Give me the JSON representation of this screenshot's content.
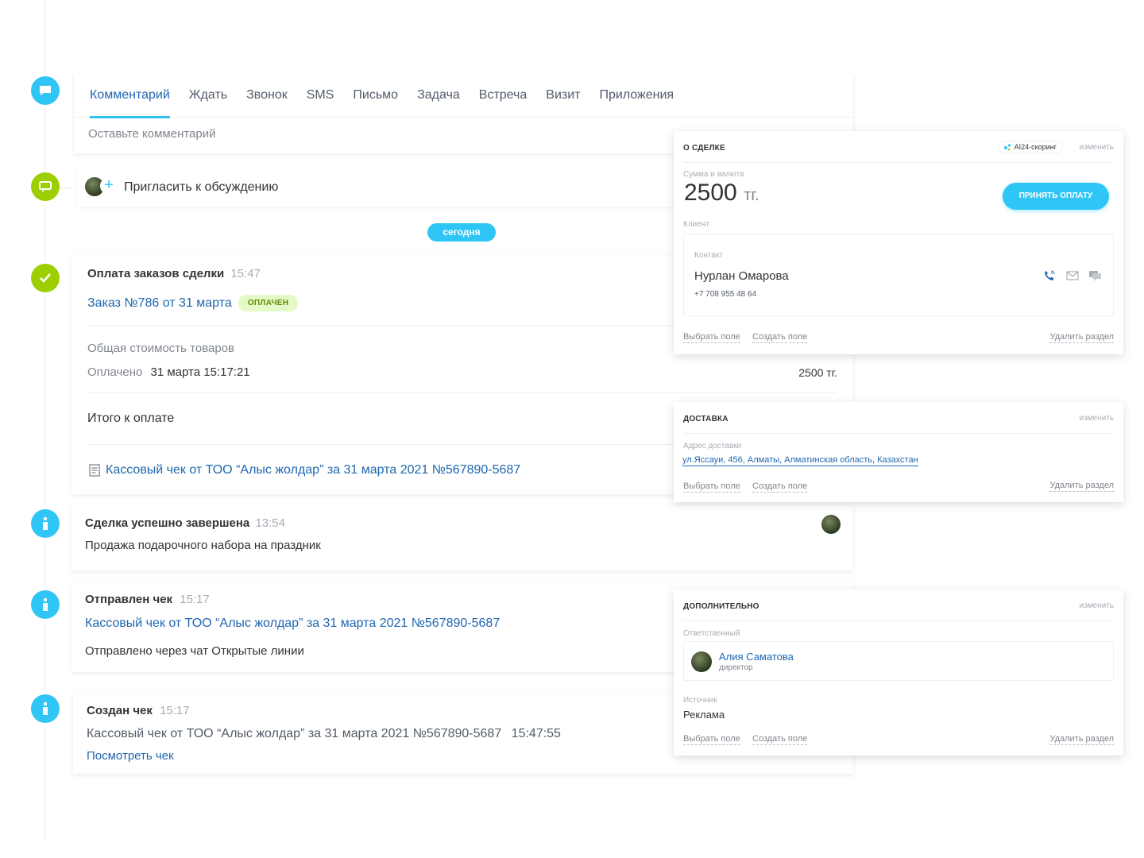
{
  "tabs": [
    "Комментарий",
    "Ждать",
    "Звонок",
    "SMS",
    "Письмо",
    "Задача",
    "Встреча",
    "Визит",
    "Приложения"
  ],
  "comment_placeholder": "Оставьте комментарий",
  "invite": {
    "label": "Пригласить к обсуждению"
  },
  "today_label": "сегодня",
  "payment": {
    "title": "Оплата заказов сделки",
    "time": "15:47",
    "order_link": "Заказ №786 от 31 марта",
    "status_badge": "ОПЛАЧЕН",
    "total_label": "Общая стоимость товаров",
    "paid_label": "Оплачено",
    "paid_datetime": "31 марта 15:17:21",
    "paid_amount": "2500 тг.",
    "due_label": "Итого к оплате",
    "receipt_link": "Кассовый чек от ТОО “Алыс жолдар” за 31 марта 2021 №567890-5687"
  },
  "deal_done": {
    "title": "Сделка успешно завершена",
    "time": "13:54",
    "text": "Продажа подарочного набора на праздник"
  },
  "check_sent": {
    "title": "Отправлен чек",
    "time": "15:17",
    "link": "Кассовый чек от ТОО “Алыс жолдар” за 31 марта 2021 №567890-5687",
    "text": "Отправлено через чат Открытые линии"
  },
  "check_created": {
    "title": "Создан чек",
    "time": "15:17",
    "text": "Кассовый чек от ТОО “Алыс жолдар” за 31 марта 2021 №567890-5687",
    "text_time": "15:47:55",
    "view_link": "Посмотреть чек"
  },
  "about_deal": {
    "title": "о сделке",
    "ai_badge": "AI24-скоринг",
    "change": "изменить",
    "sum_label": "Сумма и валюта",
    "amount": "2500",
    "currency": "тг.",
    "pay_button": "принять оплату",
    "client_label": "Клиент",
    "contact_label": "Контакт",
    "contact_name": "Нурлан Омарова",
    "contact_phone": "+7 708 955 48 64",
    "choose_field": "Выбрать поле",
    "create_field": "Создать поле",
    "delete_section": "Удалить раздел"
  },
  "delivery": {
    "title": "доставка",
    "change": "изменить",
    "address_label": "Адрес доставки",
    "address": "ул.Яссауи, 456, Алматы, Алматинская область, Казахстан",
    "choose_field": "Выбрать поле",
    "create_field": "Создать поле",
    "delete_section": "Удалить раздел"
  },
  "additional": {
    "title": "дополнительно",
    "change": "изменить",
    "responsible_label": "Ответственный",
    "responsible_name": "Алия Саматова",
    "responsible_role": "директор",
    "source_label": "Источник",
    "source_value": "Реклама",
    "choose_field": "Выбрать поле",
    "create_field": "Создать поле",
    "delete_section": "Удалить раздел"
  },
  "colors": {
    "accent": "#2fc6f6",
    "link": "#2067b0",
    "green": "#9dcf00"
  }
}
